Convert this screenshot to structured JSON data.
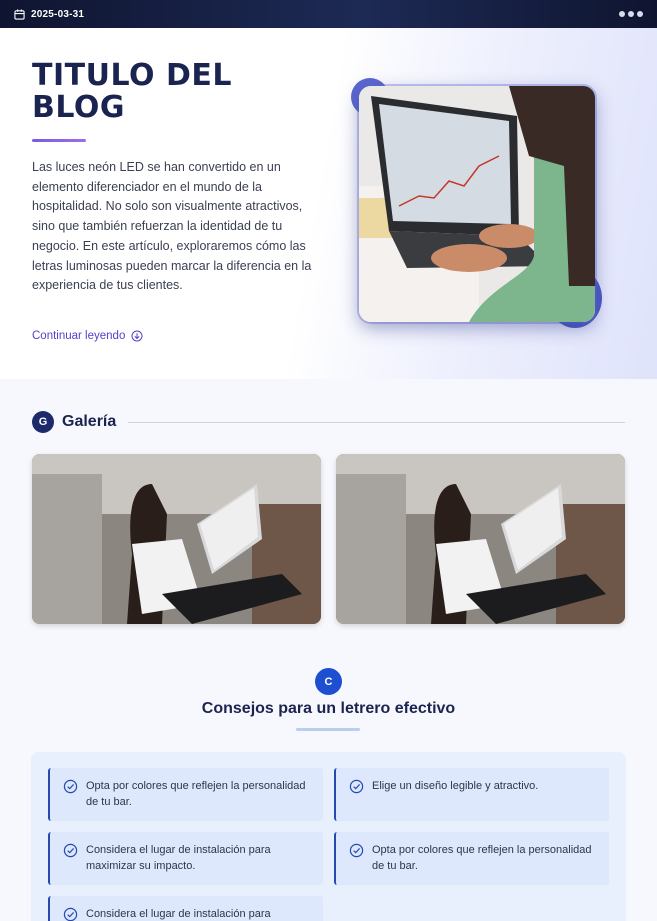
{
  "topbar": {
    "date": "2025-03-31",
    "icons": [
      "calendar-icon",
      "more-icon"
    ]
  },
  "hero": {
    "title": "TITULO DEL BLOG",
    "text": "Las luces neón LED se han convertido en un elemento diferenciador en el mundo de la hospitalidad. No solo son visualmente atractivos, sino que también refuerzan la identidad de tu negocio. En este artículo, exploraremos cómo las letras luminosas pueden marcar la diferencia en la experiencia de tus clientes.",
    "read_more": "Continuar leyendo"
  },
  "gallery": {
    "badge": "G",
    "title": "Galería"
  },
  "tips": {
    "badge": "C",
    "title": "Consejos para un letrero efectivo",
    "items": [
      "Opta por colores que reflejen la personalidad de tu bar.",
      "Elige un diseño legible y atractivo.",
      "Considera el lugar de instalación para maximizar su impacto.",
      "Opta por colores que reflejen la personalidad de tu bar.",
      "Considera el lugar de instalación para"
    ]
  },
  "colors": {
    "accent": "#5641c8",
    "navy": "#1b2450",
    "tip_bg": "#dde8fc",
    "blue_badge": "#1e4fd0"
  }
}
